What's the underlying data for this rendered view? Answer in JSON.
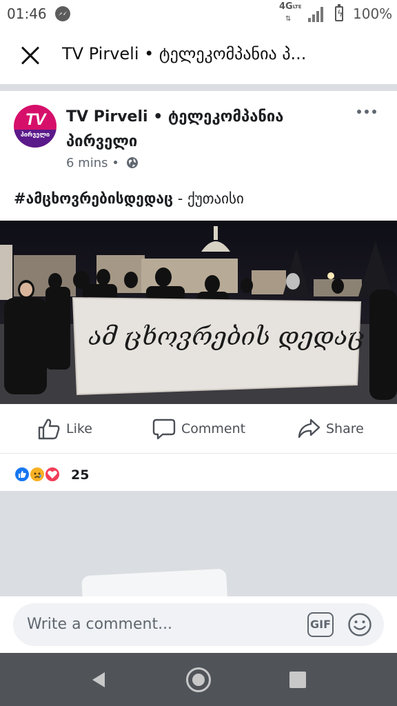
{
  "status_bar": {
    "time": "01:46",
    "network": "4G",
    "network_sub": "LTE",
    "battery": "100%",
    "icons": [
      "messenger-icon",
      "signal-icon",
      "battery-icon"
    ]
  },
  "header": {
    "title": "TV Pirveli • ტელეკომპანია პ...",
    "close_icon": "close-icon"
  },
  "post": {
    "avatar_text": "TV",
    "avatar_subtext": "პირველი",
    "author": "TV Pirveli • ტელეკომპანია პირველი",
    "time": "6 mins",
    "separator": "•",
    "privacy_icon": "globe-icon",
    "text_hashtag": "#ამცხოვრებისდედაც",
    "text_rest": " - ქუთაისი",
    "photo_banner_text": "ამ ცხოვრების დედაც"
  },
  "actions": {
    "like": "Like",
    "comment": "Comment",
    "share": "Share"
  },
  "reactions": {
    "types": [
      "like",
      "sad",
      "love"
    ],
    "count": "25"
  },
  "comment_bar": {
    "placeholder": "Write a comment...",
    "gif_label": "GIF"
  },
  "colors": {
    "facebook_blue": "#1877f2",
    "love_red": "#f33e58",
    "sad_yellow": "#f7b125",
    "brand_pink": "#d6106a"
  }
}
